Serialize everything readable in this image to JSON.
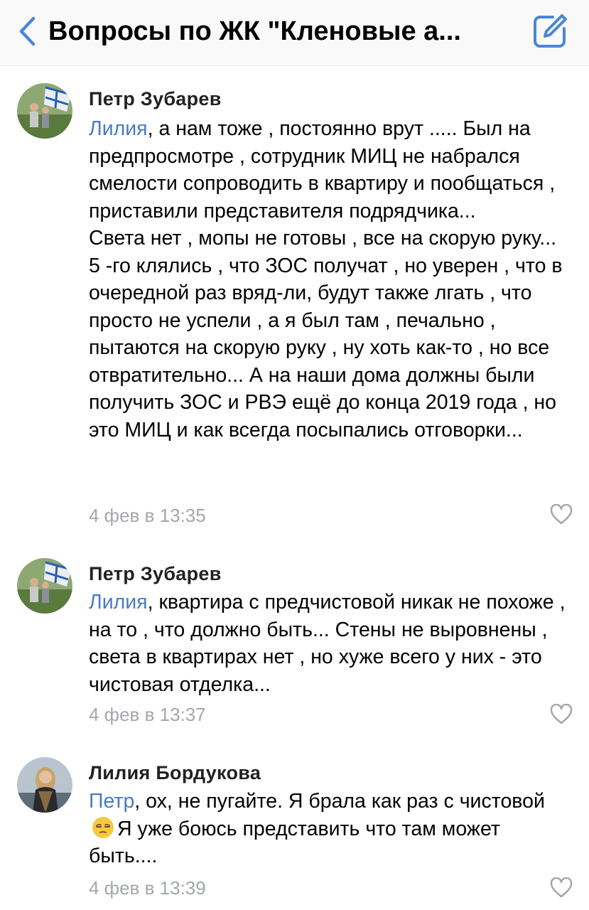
{
  "header": {
    "title": "Вопросы по ЖК \"Кленовые а...",
    "accent_color": "#4a86d8"
  },
  "comments": [
    {
      "author": "Петр Зубарев",
      "mention": "Лилия",
      "text_after_mention": ", а нам тоже , постоянно врут ..... Был на предпросмотре , сотрудник МИЦ не набрался смелости сопроводить в квартиру и пообщаться , приставили представителя подрядчика...",
      "paragraph2": "Света нет , мопы не готовы , все на скорую руку... 5 -го клялись , что ЗОС получат , но уверен , что в очередной раз вряд-ли, будут также лгать , что просто не успели , а я был там , печально , пытаются на скорую руку , ну хоть как-то , но все отвратительно... А на наши дома должны были получить ЗОС и РВЭ ещё до конца 2019 года , но это МИЦ и как всегда посыпались отговорки...",
      "date": "4 фев в 13:35",
      "avatar_icon": "avatar-flag-photo"
    },
    {
      "author": "Петр Зубарев",
      "mention": "Лилия",
      "text_after_mention": ", квартира с предчистовой никак не похоже , на то , что должно быть... Стены не выровнены , света в квартирах нет , но хуже всего у них - это чистовая отделка...",
      "date": "4 фев в 13:37",
      "avatar_icon": "avatar-flag-photo"
    },
    {
      "author": "Лилия Бордукова",
      "mention": "Петр",
      "text_before_emoji": ", ох, не пугайте. Я брала как раз с чистовой",
      "emoji": "unamused-face-icon",
      "text_after_emoji": "Я уже боюсь представить что там может быть....",
      "date": "4 фев в 13:39",
      "avatar_icon": "avatar-woman-photo"
    }
  ]
}
